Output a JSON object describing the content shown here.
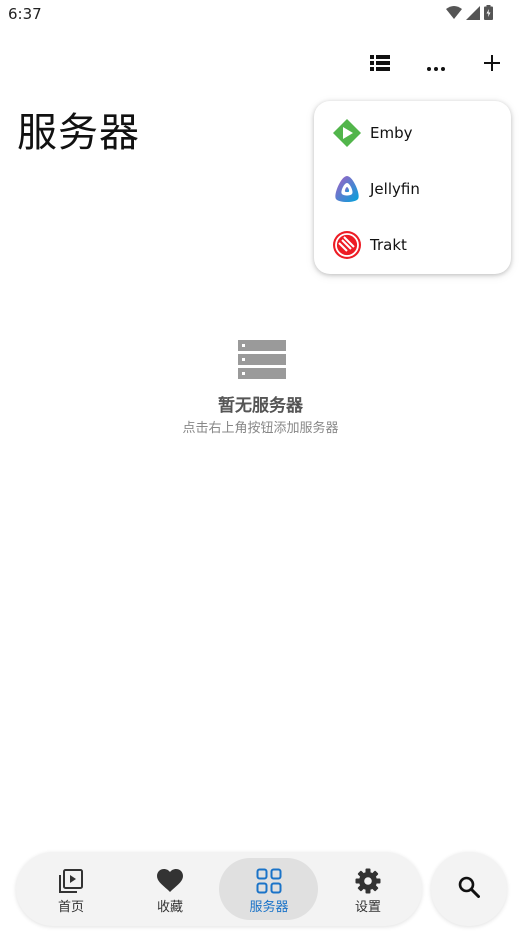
{
  "status_bar": {
    "time": "6:37"
  },
  "toolbar": {
    "icons": [
      "list-icon",
      "more-icon",
      "add-icon"
    ]
  },
  "page": {
    "title": "服务器"
  },
  "add_menu": {
    "items": [
      {
        "label": "Emby",
        "icon": "emby-icon"
      },
      {
        "label": "Jellyfin",
        "icon": "jellyfin-icon"
      },
      {
        "label": "Trakt",
        "icon": "trakt-icon"
      }
    ]
  },
  "empty_state": {
    "title": "暂无服务器",
    "subtitle": "点击右上角按钮添加服务器"
  },
  "bottom_nav": {
    "items": [
      {
        "label": "首页",
        "icon": "play-library-icon"
      },
      {
        "label": "收藏",
        "icon": "heart-icon"
      },
      {
        "label": "服务器",
        "icon": "grid-icon",
        "active": true
      },
      {
        "label": "设置",
        "icon": "gear-icon"
      }
    ]
  },
  "colors": {
    "active": "#1a73c8",
    "emby": "#52b54b",
    "trakt": "#ed1c24"
  }
}
